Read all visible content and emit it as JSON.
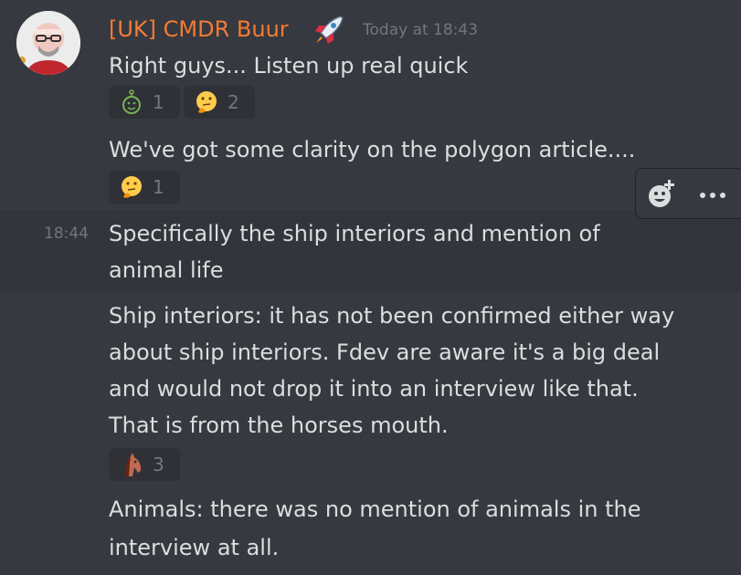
{
  "message_group": {
    "author": "[UK] CMDR Buur",
    "author_badge_icon": "rocket-icon",
    "author_color": "#f47b35",
    "timestamp": "Today at 18:43",
    "messages": [
      {
        "text": "Right guys... Listen up real quick",
        "reactions": [
          {
            "emoji": "alien-face-icon",
            "count": "1"
          },
          {
            "emoji": "thinking-face-icon",
            "count": "2"
          }
        ]
      },
      {
        "text": "We've got some clarity on the polygon article....",
        "reactions": [
          {
            "emoji": "thinking-face-icon",
            "count": "1"
          }
        ]
      },
      {
        "time": "18:44",
        "lines": [
          "Specifically the ship interiors and mention of",
          "animal life"
        ]
      },
      {
        "lines": [
          "Ship interiors: it has not been confirmed either way",
          "about ship interiors.  Fdev are aware it's a big deal",
          "and would not drop it into an interview like that.",
          "That is from the horses mouth."
        ],
        "reactions": [
          {
            "emoji": "horse-face-icon",
            "count": "3"
          }
        ]
      },
      {
        "lines": [
          "Animals: there was no mention of animals in the",
          "interview at all."
        ]
      }
    ]
  },
  "toolbar": {
    "add_reaction_icon": "add-reaction-icon",
    "more_icon": "more-options-icon"
  }
}
